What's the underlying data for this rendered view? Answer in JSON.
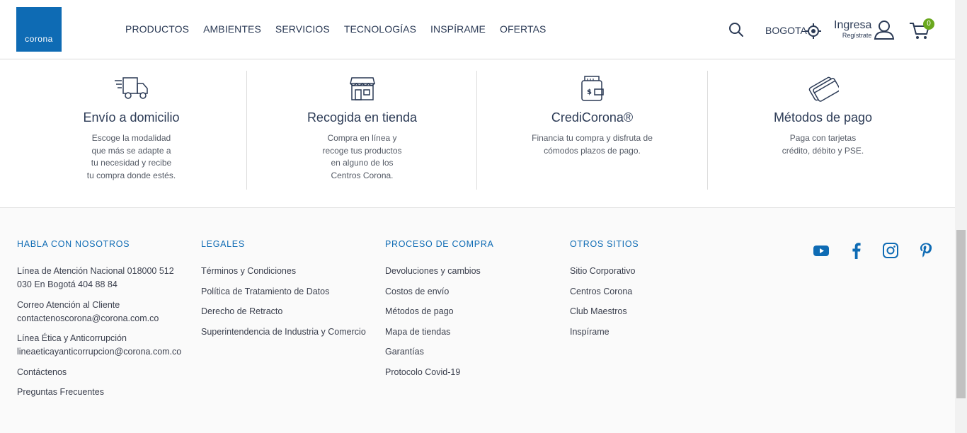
{
  "header": {
    "logo_text": "corona",
    "nav": [
      "PRODUCTOS",
      "AMBIENTES",
      "SERVICIOS",
      "TECNOLOGÍAS",
      "INSPÍRAME",
      "OFERTAS"
    ],
    "city": "BOGOTA",
    "login_label": "Ingresa",
    "register_label": "Regístrate",
    "cart_count": "0",
    "brand_color": "#0e6bb4",
    "badge_color": "#6aa81e"
  },
  "services": [
    {
      "title": "Envío a domicilio",
      "desc": [
        "Escoge la modalidad",
        "que más se adapte a",
        "tu necesidad y recibe",
        "tu compra donde estés."
      ],
      "icon": "truck-icon"
    },
    {
      "title": "Recogida en tienda",
      "desc": [
        "Compra en línea y",
        "recoge tus productos",
        "en alguno de los",
        "Centros Corona."
      ],
      "icon": "store-icon"
    },
    {
      "title": "CrediCorona®",
      "desc": [
        "Financia tu compra y disfruta de",
        "cómodos plazos de pago."
      ],
      "icon": "wallet-icon"
    },
    {
      "title": "Métodos de pago",
      "desc": [
        "Paga con tarjetas",
        "crédito, débito y PSE."
      ],
      "icon": "cards-icon"
    }
  ],
  "footer": {
    "columns": [
      {
        "title": "HABLA CON NOSOTROS",
        "items": [
          "Línea de Atención Nacional 018000 512 030 En Bogotá 404 88 84",
          "Correo Atención al Cliente contactenoscorona@corona.com.co",
          "Línea Ética y Anticorrupción lineaeticayanticorrupcion@corona.com.co",
          "Contáctenos",
          "Preguntas Frecuentes"
        ]
      },
      {
        "title": "LEGALES",
        "items": [
          "Términos y Condiciones",
          "Política de Tratamiento de Datos",
          "Derecho de Retracto",
          "Superintendencia de Industria y Comercio"
        ]
      },
      {
        "title": "PROCESO DE COMPRA",
        "items": [
          "Devoluciones y cambios",
          "Costos de envío",
          "Métodos de pago",
          "Mapa de tiendas",
          "Garantías",
          "Protocolo Covid-19"
        ]
      },
      {
        "title": "OTROS SITIOS",
        "items": [
          "Sitio Corporativo",
          "Centros Corona",
          "Club Maestros",
          "Inspírame"
        ]
      }
    ],
    "social": [
      "youtube-icon",
      "facebook-icon",
      "instagram-icon",
      "pinterest-icon"
    ]
  }
}
